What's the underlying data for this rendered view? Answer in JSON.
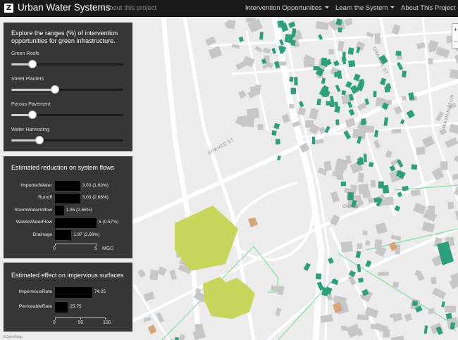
{
  "app": {
    "logo_letter": "Z",
    "title": "Urban Water Systems",
    "about_link": "- about this project"
  },
  "nav": {
    "items": [
      {
        "label": "Intervention Opportunities"
      },
      {
        "label": "Learn the System"
      },
      {
        "label": "About This Project"
      }
    ]
  },
  "map": {
    "street_labels": [
      "SPRUCE ST",
      "ORANGE ST",
      "WASHINGTON",
      "Chelsea"
    ],
    "zoom_in": "+",
    "zoom_out": "−",
    "attribution": "©OpenMap"
  },
  "sliders_panel": {
    "title": "Explore the ranges (%) of intervention opportunities for green infrastructure.",
    "sliders": [
      {
        "label": "Green Roofs",
        "value_fraction": 0.19
      },
      {
        "label": "Street Planters",
        "value_fraction": 0.39
      },
      {
        "label": "Porous Pavement",
        "value_fraction": 0.19
      },
      {
        "label": "Water Harvesting",
        "value_fraction": 0.25
      }
    ]
  },
  "flows_panel": {
    "title": "Estimated reduction on system flows",
    "chart_data": {
      "type": "bar",
      "orientation": "horizontal",
      "categories": [
        "ImportedWater",
        "Runoff",
        "StormWaterInflow",
        "WasteWaterFlow",
        "Drainage"
      ],
      "values": [
        3.03,
        3.03,
        1.06,
        5,
        1.97
      ],
      "value_labels": [
        "3.03 (1.63%)",
        "3.03 (2.66%)",
        "1.06 (2.66%)",
        "5 (0.57%)",
        "1.97 (2.66%)"
      ],
      "xlim": [
        0,
        5
      ],
      "ticks": [
        "0",
        "5"
      ],
      "unit": "MGD"
    }
  },
  "impervious_panel": {
    "title": "Estimated effect on impervious surfaces",
    "chart_data": {
      "type": "bar",
      "orientation": "horizontal",
      "categories": [
        "ImperviousRate",
        "PermeableRate"
      ],
      "values": [
        74.25,
        25.75
      ],
      "value_labels": [
        "74.25",
        "25.75"
      ],
      "xlim": [
        0,
        100
      ],
      "ticks": [
        "0",
        "50",
        "100"
      ]
    }
  },
  "colors": {
    "navbar": "#1b1b1b",
    "panel": "#282828",
    "bar": "#000000",
    "green_roof": "#2ba07a",
    "park": "#c6d65a",
    "boundary": "#7fe0a0",
    "orange_lot": "#d7a57a"
  }
}
